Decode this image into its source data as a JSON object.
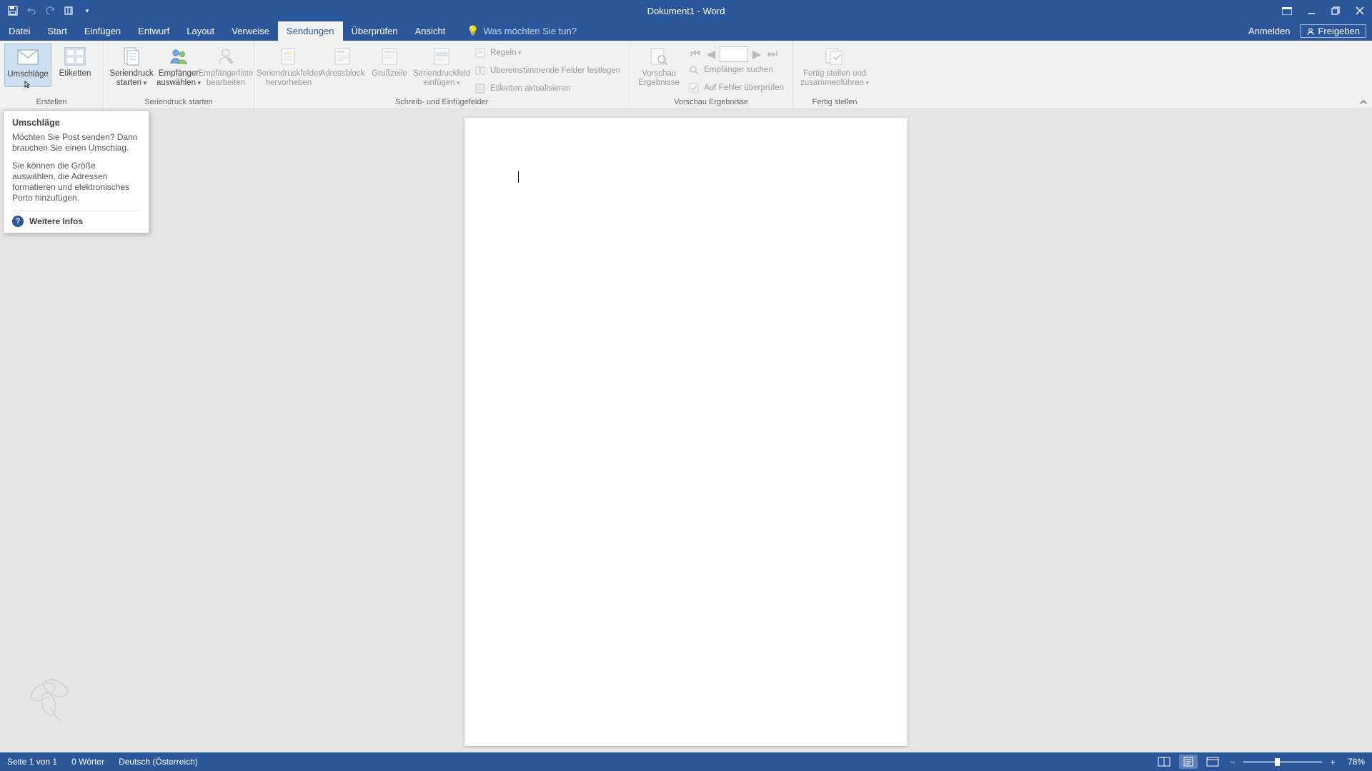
{
  "title": "Dokument1 - Word",
  "tabs": {
    "file": "Datei",
    "home": "Start",
    "insert": "Einfügen",
    "design": "Entwurf",
    "layout": "Layout",
    "references": "Verweise",
    "mailings": "Sendungen",
    "review": "Überprüfen",
    "view": "Ansicht"
  },
  "tell_me_placeholder": "Was möchten Sie tun?",
  "account": {
    "signin": "Anmelden",
    "share": "Freigeben"
  },
  "ribbon": {
    "groups": {
      "create": {
        "label": "Erstellen",
        "envelopes": "Umschläge",
        "labels": "Etiketten"
      },
      "start": {
        "label": "Seriendruck starten",
        "start_merge": "Seriendruck starten",
        "select_recipients": "Empfänger auswählen",
        "edit_recipients": "Empfängerliste bearbeiten"
      },
      "fields": {
        "label": "Schreib- und Einfügefelder",
        "highlight": "Seriendruckfelder hervorheben",
        "address_block": "Adressblock",
        "greeting": "Grußzeile",
        "insert_field": "Seriendruckfeld einfügen",
        "rules": "Regeln",
        "match_fields": "Übereinstimmende Felder festlegen",
        "update_labels": "Etiketten aktualisieren"
      },
      "preview": {
        "label": "Vorschau Ergebnisse",
        "preview_results": "Vorschau Ergebnisse",
        "find_recipient": "Empfänger suchen",
        "check_errors": "Auf Fehler überprüfen"
      },
      "finish": {
        "label": "Fertig stellen",
        "finish_merge": "Fertig stellen und zusammenführen"
      }
    }
  },
  "tooltip": {
    "title": "Umschläge",
    "p1": "Möchten Sie Post senden? Dann brauchen Sie einen Umschlag.",
    "p2": "Sie können die Größe auswählen, die Adressen formatieren und elektronisches Porto hinzufügen.",
    "more": "Weitere Infos"
  },
  "status": {
    "page": "Seite 1 von 1",
    "words": "0 Wörter",
    "lang": "Deutsch (Österreich)",
    "zoom": "78%"
  }
}
